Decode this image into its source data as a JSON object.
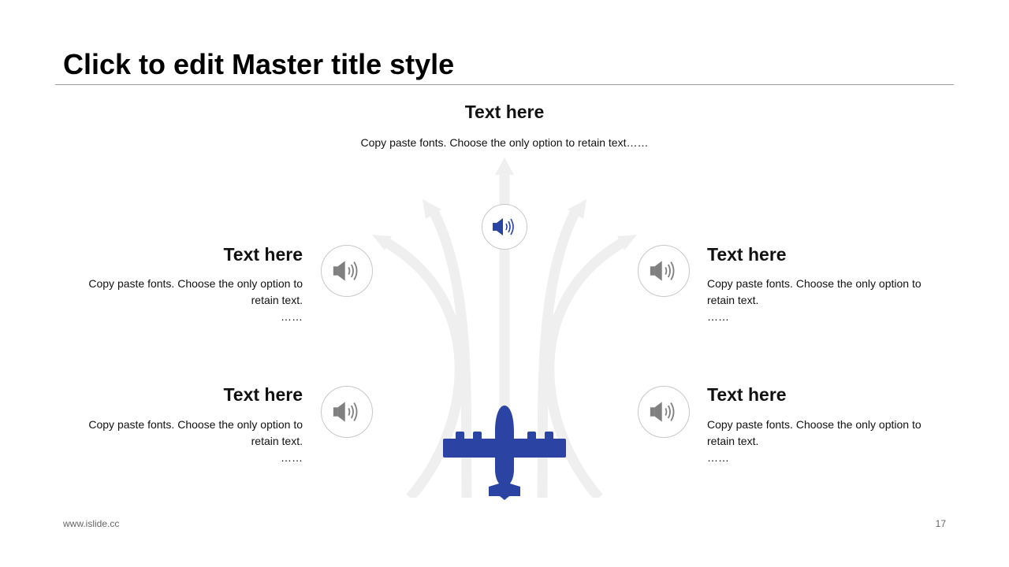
{
  "slide": {
    "title": "Click to edit Master title style",
    "footer_url": "www.islide.cc",
    "page_number": "17"
  },
  "colors": {
    "accent": "#2b44a4",
    "icon_gray": "#808080",
    "arrow_gray": "#efefef"
  },
  "items": [
    {
      "heading": "Text here",
      "desc": "Copy paste fonts. Choose the only option to retain text……",
      "icon": "speaker-icon"
    },
    {
      "heading": "Text here",
      "desc": "Copy paste fonts. Choose the only option to retain text.",
      "dots": "……",
      "icon": "speaker-icon"
    },
    {
      "heading": "Text here",
      "desc": "Copy paste fonts. Choose the only option to retain text.",
      "dots": "……",
      "icon": "speaker-icon"
    },
    {
      "heading": "Text here",
      "desc": "Copy paste fonts. Choose the only option to retain text.",
      "dots": "……",
      "icon": "speaker-icon"
    },
    {
      "heading": "Text here",
      "desc": "Copy paste fonts. Choose the only option to retain text.",
      "dots": "……",
      "icon": "speaker-icon"
    }
  ],
  "center_graphic": "airplane-icon"
}
